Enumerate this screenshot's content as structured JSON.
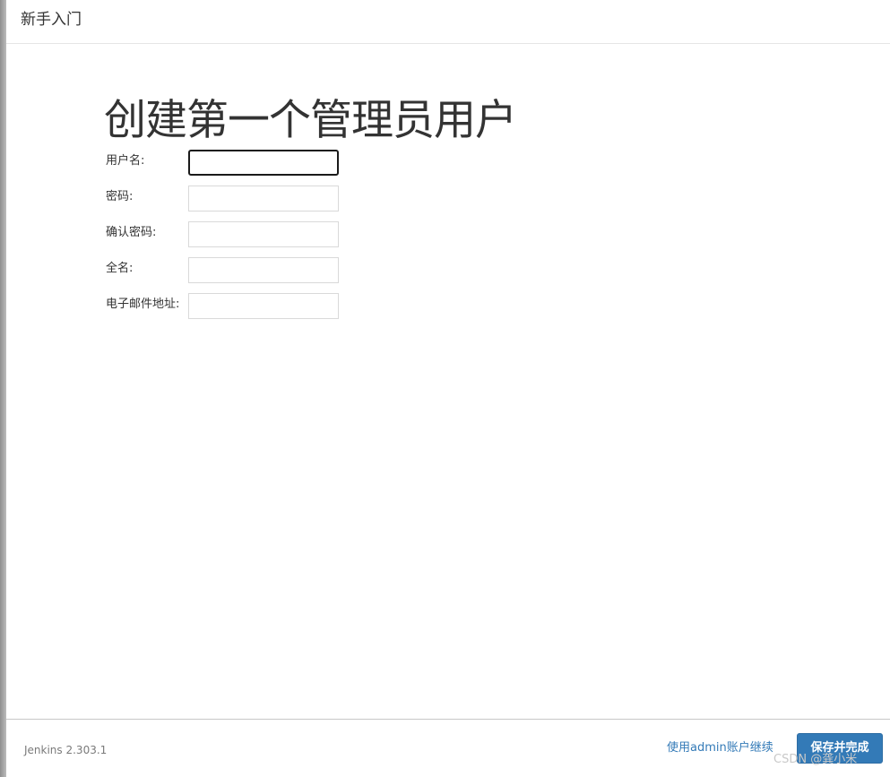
{
  "header": {
    "title": "新手入门"
  },
  "main": {
    "title": "创建第一个管理员用户",
    "fields": [
      {
        "label": "用户名:",
        "value": "",
        "focused": true
      },
      {
        "label": "密码:",
        "value": ""
      },
      {
        "label": "确认密码:",
        "value": ""
      },
      {
        "label": "全名:",
        "value": ""
      },
      {
        "label": "电子邮件地址:",
        "value": ""
      }
    ]
  },
  "footer": {
    "version": "Jenkins 2.303.1",
    "admin_link": "使用admin账户继续",
    "save_label": "保存并完成",
    "watermark": "CSDN @龚小米"
  },
  "colors": {
    "primary": "#337ab7",
    "text": "#333333"
  }
}
